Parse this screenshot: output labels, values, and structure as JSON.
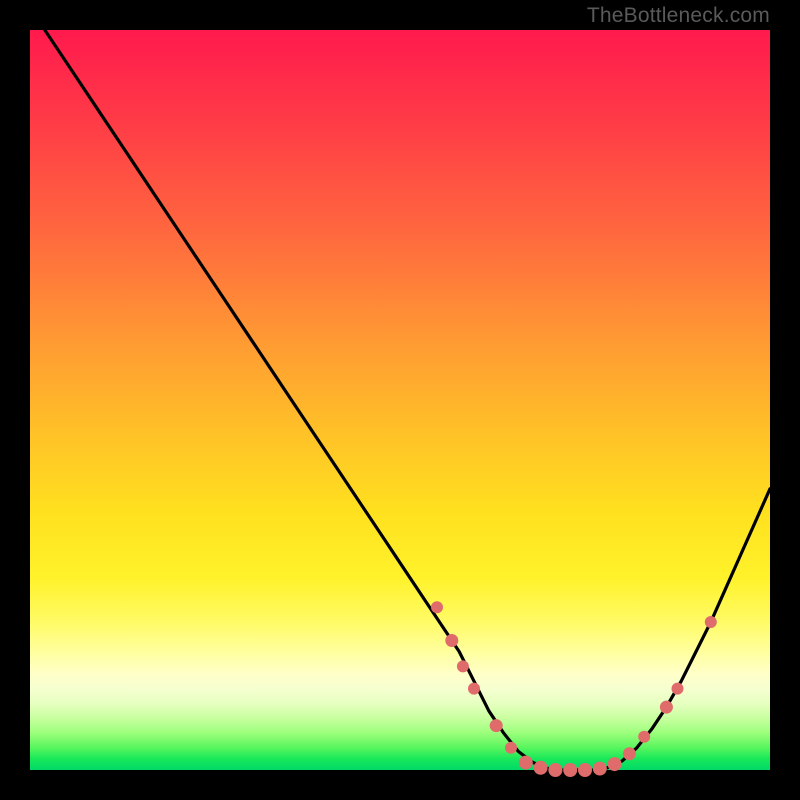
{
  "attribution": "TheBottleneck.com",
  "chart_data": {
    "type": "line",
    "title": "",
    "xlabel": "",
    "ylabel": "",
    "xlim": [
      0,
      100
    ],
    "ylim": [
      0,
      100
    ],
    "grid": false,
    "legend": false,
    "background": "heat-gradient",
    "series": [
      {
        "name": "bottleneck-curve",
        "x": [
          2,
          6,
          10,
          14,
          18,
          22,
          26,
          30,
          34,
          38,
          42,
          46,
          50,
          54,
          58,
          60,
          62,
          64,
          66,
          68,
          70,
          72,
          74,
          76,
          78,
          80,
          82,
          84,
          86,
          88,
          90,
          92,
          94,
          96,
          98,
          100
        ],
        "y": [
          100,
          94,
          88,
          82,
          76,
          70,
          64,
          58,
          52,
          46,
          40,
          34,
          28,
          22,
          16,
          12,
          8,
          5,
          2.5,
          1,
          0.2,
          0,
          0,
          0,
          0.3,
          1.2,
          3,
          5.5,
          8.5,
          12,
          16,
          20,
          24.5,
          29,
          33.5,
          38
        ]
      }
    ],
    "markers": [
      {
        "x": 55,
        "y": 22,
        "r": 6
      },
      {
        "x": 57,
        "y": 17.5,
        "r": 6.5
      },
      {
        "x": 58.5,
        "y": 14,
        "r": 6
      },
      {
        "x": 60,
        "y": 11,
        "r": 6
      },
      {
        "x": 63,
        "y": 6,
        "r": 6.5
      },
      {
        "x": 65,
        "y": 3,
        "r": 6
      },
      {
        "x": 67,
        "y": 1,
        "r": 7
      },
      {
        "x": 69,
        "y": 0.3,
        "r": 7
      },
      {
        "x": 71,
        "y": 0,
        "r": 7
      },
      {
        "x": 73,
        "y": 0,
        "r": 7
      },
      {
        "x": 75,
        "y": 0,
        "r": 7
      },
      {
        "x": 77,
        "y": 0.2,
        "r": 7
      },
      {
        "x": 79,
        "y": 0.8,
        "r": 7
      },
      {
        "x": 81,
        "y": 2.2,
        "r": 6.5
      },
      {
        "x": 83,
        "y": 4.5,
        "r": 6
      },
      {
        "x": 86,
        "y": 8.5,
        "r": 6.5
      },
      {
        "x": 87.5,
        "y": 11,
        "r": 6
      },
      {
        "x": 92,
        "y": 20,
        "r": 6
      }
    ]
  }
}
